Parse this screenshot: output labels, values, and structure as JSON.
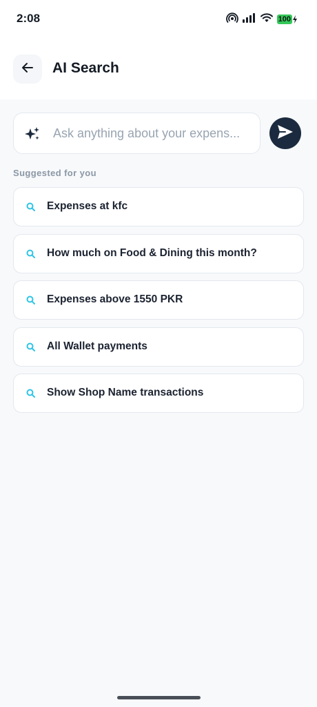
{
  "status_bar": {
    "time": "2:08",
    "battery": "100",
    "icons": [
      "hotspot-icon",
      "signal-icon",
      "wifi-icon",
      "battery-icon"
    ]
  },
  "header": {
    "title": "AI Search",
    "back_icon": "arrow-left-icon"
  },
  "search": {
    "placeholder": "Ask anything about your expens...",
    "value": "",
    "leading_icon": "sparkle-icon",
    "send_icon": "send-icon"
  },
  "suggestions": {
    "label": "Suggested for you",
    "items": [
      {
        "label": "Expenses at kfc",
        "icon": "search-icon"
      },
      {
        "label": "How much on Food & Dining this month?",
        "icon": "search-icon"
      },
      {
        "label": "Expenses above 1550 PKR",
        "icon": "search-icon"
      },
      {
        "label": "All Wallet payments",
        "icon": "search-icon"
      },
      {
        "label": "Show Shop Name transactions",
        "icon": "search-icon"
      }
    ]
  },
  "colors": {
    "accent_icon": "#2ec4e6",
    "send_button": "#1b2a3e",
    "battery_fill": "#34c759",
    "background": "#f7f9fb"
  }
}
